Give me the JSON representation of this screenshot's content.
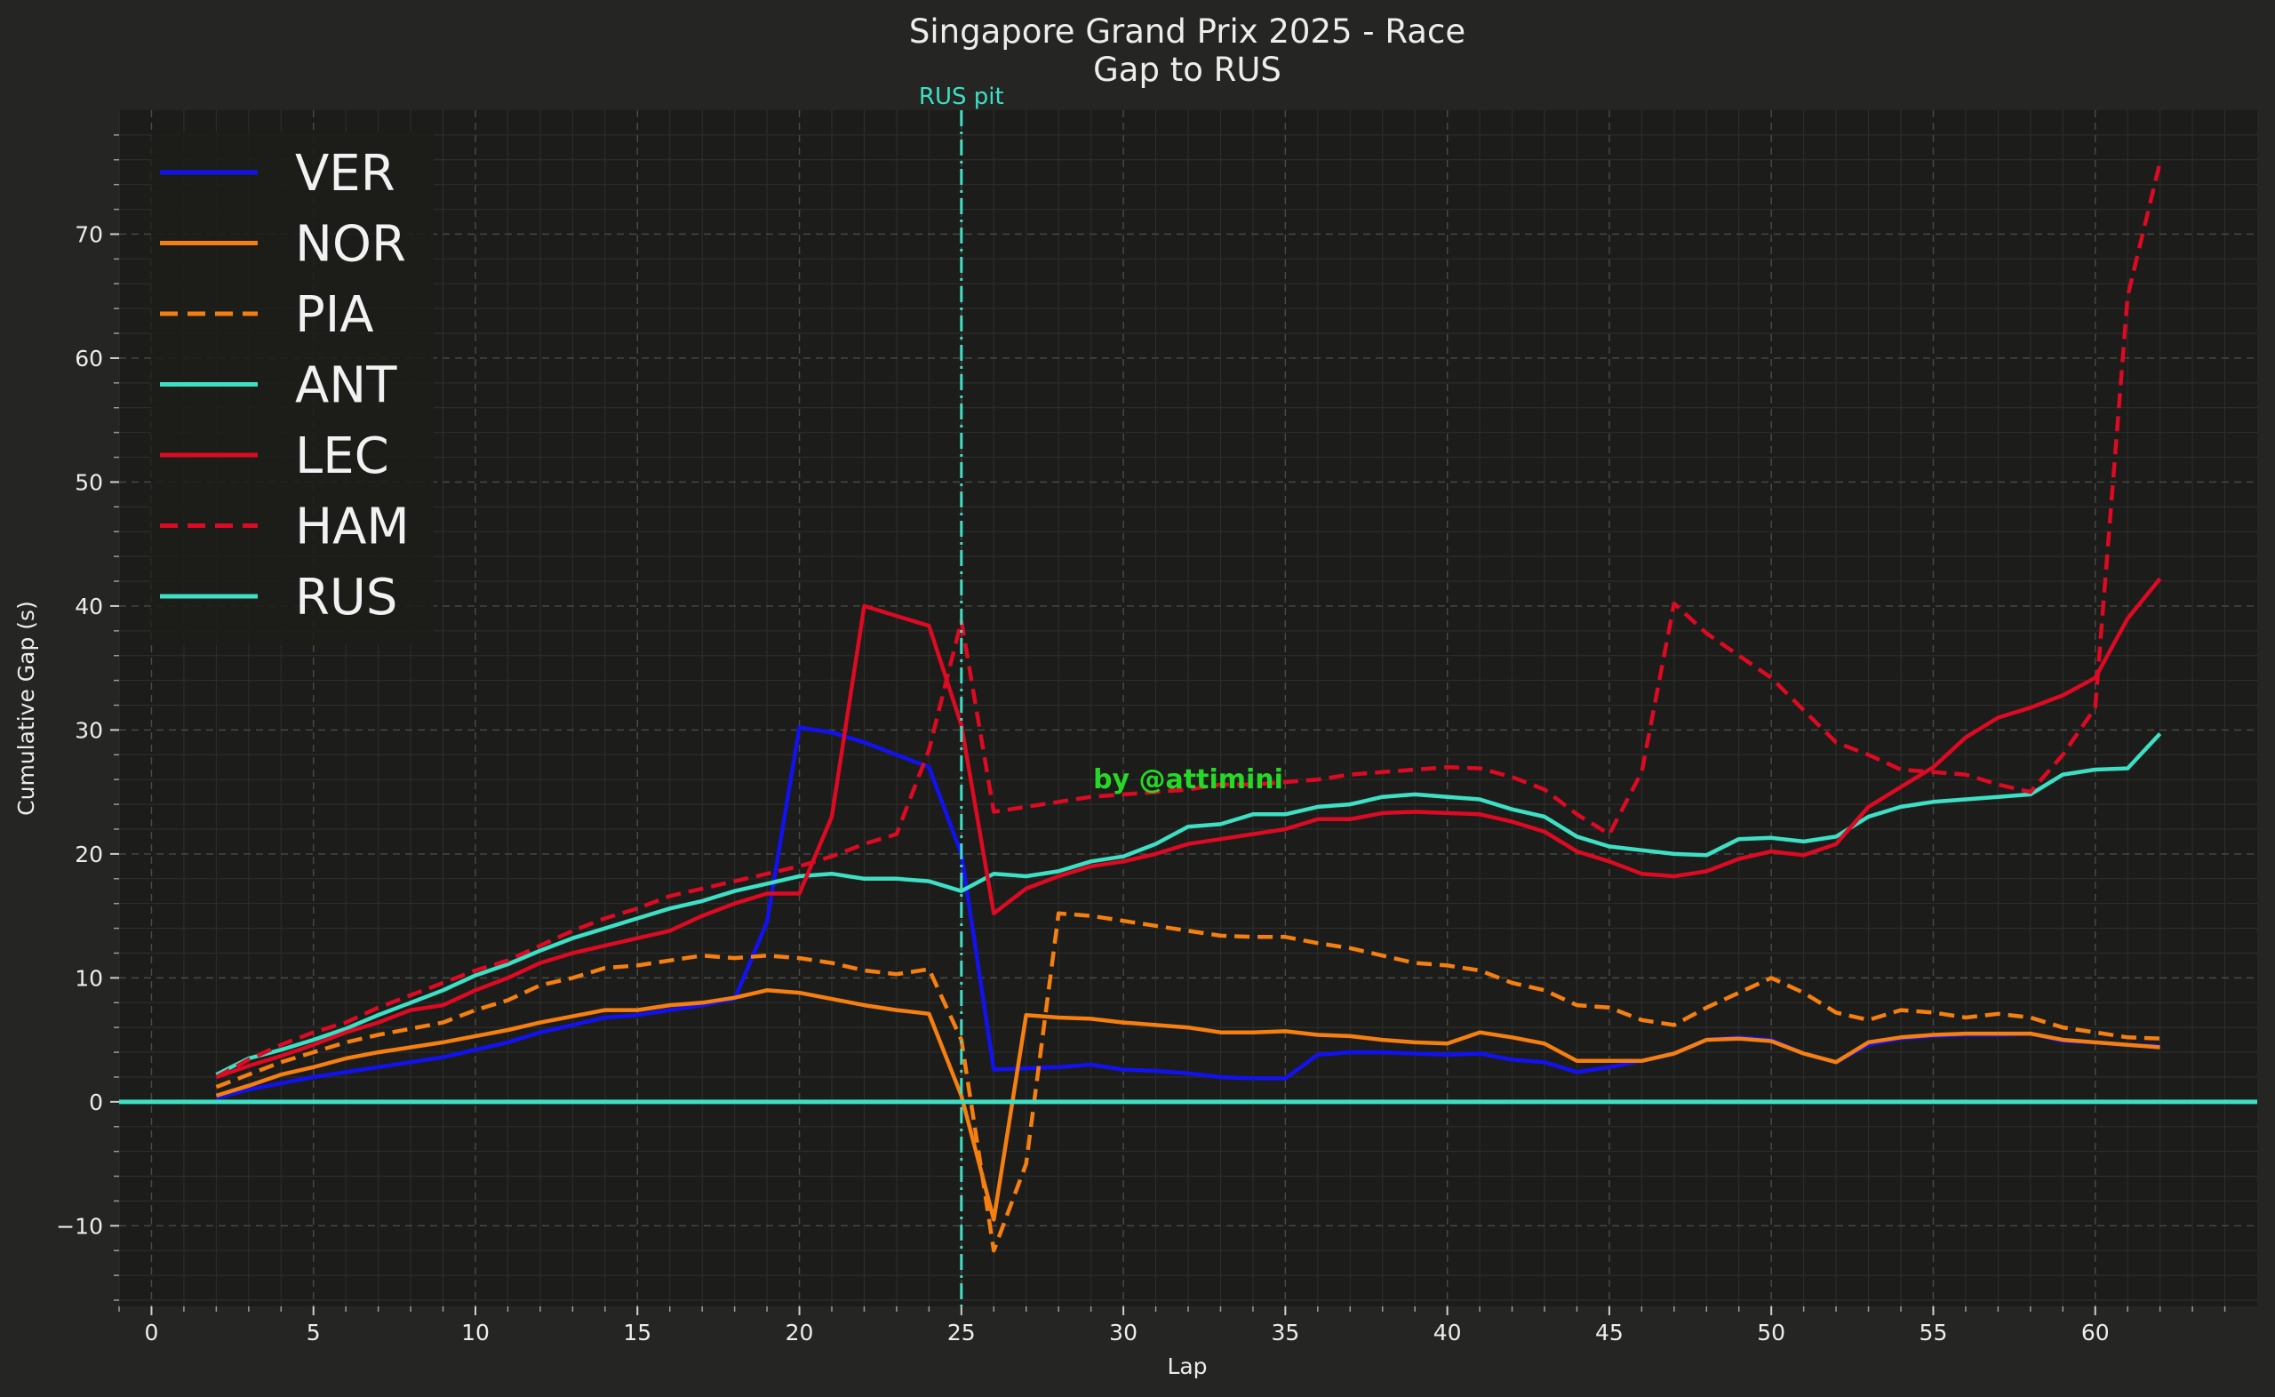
{
  "chart_data": {
    "type": "line",
    "title": "Singapore Grand Prix 2025 - Race",
    "subtitle": "Gap to RUS",
    "xlabel": "Lap",
    "ylabel": "Cumulative Gap (s)",
    "xlim": [
      -1,
      65
    ],
    "ylim": [
      -16.5,
      80
    ],
    "xticks": [
      0,
      5,
      10,
      15,
      20,
      25,
      30,
      35,
      40,
      45,
      50,
      55,
      60
    ],
    "yticks": [
      -10,
      0,
      10,
      20,
      30,
      40,
      50,
      60,
      70
    ],
    "grid": true,
    "legend_position": "top-left",
    "background": "#1c1c1a",
    "figure_background": "#252523",
    "annotations": {
      "pit_line": {
        "x": 25,
        "label": "RUS pit",
        "color": "#3de0c4"
      },
      "credit": {
        "text": "by @attimini",
        "x": 32,
        "y": 26,
        "color": "#27d927"
      }
    },
    "series": [
      {
        "name": "VER",
        "color": "#1212f0",
        "dash": "solid",
        "x": [
          2,
          3,
          4,
          5,
          6,
          7,
          8,
          9,
          10,
          11,
          12,
          13,
          14,
          15,
          16,
          17,
          18,
          19,
          20,
          21,
          22,
          23,
          24,
          25,
          26,
          27,
          28,
          29,
          30,
          31,
          32,
          33,
          34,
          35,
          36,
          37,
          38,
          39,
          40,
          41,
          42,
          43,
          44,
          45,
          46,
          47,
          48,
          49,
          50,
          51,
          52,
          53,
          54,
          55,
          56,
          57,
          58,
          59,
          60,
          61,
          62
        ],
        "y": [
          0.3,
          1.0,
          1.5,
          2.0,
          2.4,
          2.8,
          3.2,
          3.6,
          4.2,
          4.8,
          5.6,
          6.2,
          6.8,
          7.0,
          7.4,
          7.8,
          8.3,
          14.5,
          30.2,
          29.8,
          29.0,
          28.0,
          27.0,
          20.0,
          2.6,
          2.7,
          2.8,
          3.0,
          2.6,
          2.5,
          2.3,
          2.0,
          1.9,
          1.9,
          3.8,
          4.0,
          4.0,
          3.9,
          3.8,
          3.9,
          3.4,
          3.2,
          2.4,
          2.8,
          3.3,
          3.9,
          5.0,
          5.2,
          5.0,
          3.9,
          3.2,
          4.6,
          5.1,
          5.3,
          5.4,
          5.4,
          5.5,
          4.9,
          4.8,
          4.6,
          4.5
        ]
      },
      {
        "name": "NOR",
        "color": "#f57f10",
        "dash": "solid",
        "x": [
          2,
          3,
          4,
          5,
          6,
          7,
          8,
          9,
          10,
          11,
          12,
          13,
          14,
          15,
          16,
          17,
          18,
          19,
          20,
          21,
          22,
          23,
          24,
          25,
          26,
          27,
          28,
          29,
          30,
          31,
          32,
          33,
          34,
          35,
          36,
          37,
          38,
          39,
          40,
          41,
          42,
          43,
          44,
          45,
          46,
          47,
          48,
          49,
          50,
          51,
          52,
          53,
          54,
          55,
          56,
          57,
          58,
          59,
          60,
          61,
          62
        ],
        "y": [
          0.5,
          1.3,
          2.2,
          2.8,
          3.5,
          4.0,
          4.4,
          4.8,
          5.3,
          5.8,
          6.4,
          6.9,
          7.4,
          7.4,
          7.8,
          8.0,
          8.4,
          9.0,
          8.8,
          8.3,
          7.8,
          7.4,
          7.1,
          0.5,
          -9.5,
          7.0,
          6.8,
          6.7,
          6.4,
          6.2,
          6.0,
          5.6,
          5.6,
          5.7,
          5.4,
          5.3,
          5.0,
          4.8,
          4.7,
          5.6,
          5.2,
          4.7,
          3.3,
          3.3,
          3.3,
          3.9,
          5.0,
          5.1,
          4.9,
          3.9,
          3.2,
          4.8,
          5.2,
          5.4,
          5.5,
          5.5,
          5.5,
          5.0,
          4.8,
          4.6,
          4.4
        ]
      },
      {
        "name": "PIA",
        "color": "#f57f10",
        "dash": "dashed",
        "x": [
          2,
          3,
          4,
          5,
          6,
          7,
          8,
          9,
          10,
          11,
          12,
          13,
          14,
          15,
          16,
          17,
          18,
          19,
          20,
          21,
          22,
          23,
          24,
          25,
          26,
          27,
          28,
          29,
          30,
          31,
          32,
          33,
          34,
          35,
          36,
          37,
          38,
          39,
          40,
          41,
          42,
          43,
          44,
          45,
          46,
          47,
          48,
          49,
          50,
          51,
          52,
          53,
          54,
          55,
          56,
          57,
          58,
          59,
          60,
          61,
          62
        ],
        "y": [
          1.2,
          2.2,
          3.2,
          4.0,
          4.8,
          5.4,
          5.9,
          6.4,
          7.4,
          8.2,
          9.4,
          10.0,
          10.8,
          11.0,
          11.4,
          11.8,
          11.6,
          11.8,
          11.6,
          11.2,
          10.6,
          10.3,
          10.7,
          5.0,
          -12.0,
          -5.0,
          15.2,
          15.0,
          14.6,
          14.2,
          13.8,
          13.4,
          13.3,
          13.3,
          12.8,
          12.4,
          11.8,
          11.2,
          11.0,
          10.6,
          9.6,
          9.0,
          7.8,
          7.6,
          6.6,
          6.2,
          7.6,
          8.8,
          10.0,
          8.8,
          7.2,
          6.6,
          7.4,
          7.2,
          6.8,
          7.1,
          6.8,
          6.0,
          5.6,
          5.2,
          5.1
        ]
      },
      {
        "name": "ANT",
        "color": "#3de0c4",
        "dash": "solid",
        "x": [
          2,
          3,
          4,
          5,
          6,
          7,
          8,
          9,
          10,
          11,
          12,
          13,
          14,
          15,
          16,
          17,
          18,
          19,
          20,
          21,
          22,
          23,
          24,
          25,
          26,
          27,
          28,
          29,
          30,
          31,
          32,
          33,
          34,
          35,
          36,
          37,
          38,
          39,
          40,
          41,
          42,
          43,
          44,
          45,
          46,
          47,
          48,
          49,
          50,
          51,
          52,
          53,
          54,
          55,
          56,
          57,
          58,
          59,
          60,
          61,
          62
        ],
        "y": [
          2.2,
          3.5,
          4.2,
          5.0,
          5.9,
          7.0,
          8.0,
          9.0,
          10.2,
          11.1,
          12.2,
          13.2,
          14.0,
          14.8,
          15.6,
          16.2,
          17.0,
          17.6,
          18.2,
          18.4,
          18.0,
          18.0,
          17.8,
          17.0,
          18.4,
          18.2,
          18.6,
          19.4,
          19.8,
          20.8,
          22.2,
          22.4,
          23.2,
          23.2,
          23.8,
          24.0,
          24.6,
          24.8,
          24.6,
          24.4,
          23.6,
          23.0,
          21.4,
          20.6,
          20.3,
          20.0,
          19.9,
          21.2,
          21.3,
          21.0,
          21.4,
          23.0,
          23.8,
          24.2,
          24.4,
          24.6,
          24.8,
          26.4,
          26.8,
          26.9,
          29.7
        ]
      },
      {
        "name": "LEC",
        "color": "#dc0a22",
        "dash": "solid",
        "x": [
          2,
          3,
          4,
          5,
          6,
          7,
          8,
          9,
          10,
          11,
          12,
          13,
          14,
          15,
          16,
          17,
          18,
          19,
          20,
          21,
          22,
          23,
          24,
          25,
          26,
          27,
          28,
          29,
          30,
          31,
          32,
          33,
          34,
          35,
          36,
          37,
          38,
          39,
          40,
          41,
          42,
          43,
          44,
          45,
          46,
          47,
          48,
          49,
          50,
          51,
          52,
          53,
          54,
          55,
          56,
          57,
          58,
          59,
          60,
          61,
          62
        ],
        "y": [
          2.0,
          2.9,
          3.7,
          4.6,
          5.6,
          6.4,
          7.4,
          7.8,
          9.0,
          10.0,
          11.2,
          12.0,
          12.6,
          13.2,
          13.8,
          15.0,
          16.0,
          16.8,
          16.8,
          23.0,
          40.0,
          39.2,
          38.4,
          30.4,
          15.2,
          17.2,
          18.2,
          19.0,
          19.4,
          20.0,
          20.8,
          21.2,
          21.6,
          22.0,
          22.8,
          22.8,
          23.3,
          23.4,
          23.3,
          23.2,
          22.6,
          21.8,
          20.2,
          19.4,
          18.4,
          18.2,
          18.6,
          19.6,
          20.2,
          19.9,
          20.8,
          23.8,
          25.4,
          27.0,
          29.4,
          31.0,
          31.8,
          32.8,
          34.2,
          39.0,
          42.2
        ]
      },
      {
        "name": "HAM",
        "color": "#dc0a22",
        "dash": "dashed",
        "x": [
          2,
          3,
          4,
          5,
          6,
          7,
          8,
          9,
          10,
          11,
          12,
          13,
          14,
          15,
          16,
          17,
          18,
          19,
          20,
          21,
          22,
          23,
          24,
          25,
          26,
          27,
          28,
          29,
          30,
          31,
          32,
          33,
          34,
          35,
          36,
          37,
          38,
          39,
          40,
          41,
          42,
          43,
          44,
          45,
          46,
          47,
          48,
          49,
          50,
          51,
          52,
          53,
          54,
          55,
          56,
          57,
          58,
          59,
          60,
          61,
          62
        ],
        "y": [
          2.0,
          3.4,
          4.6,
          5.6,
          6.4,
          7.6,
          8.6,
          9.6,
          10.6,
          11.4,
          12.6,
          13.8,
          14.8,
          15.6,
          16.6,
          17.2,
          17.8,
          18.4,
          19.0,
          19.8,
          20.8,
          21.6,
          28.4,
          38.8,
          23.4,
          23.8,
          24.2,
          24.6,
          24.8,
          25.0,
          25.2,
          25.6,
          25.6,
          25.8,
          26.0,
          26.4,
          26.6,
          26.8,
          27.0,
          26.9,
          26.2,
          25.2,
          23.2,
          21.6,
          26.6,
          40.2,
          37.8,
          36.0,
          34.2,
          31.6,
          29.0,
          28.0,
          26.8,
          26.6,
          26.4,
          25.6,
          25.0,
          28.0,
          31.8,
          65.0,
          75.8
        ]
      },
      {
        "name": "RUS",
        "color": "#3de0c4",
        "dash": "solid",
        "x": [
          -1,
          65
        ],
        "y": [
          0,
          0
        ]
      }
    ]
  }
}
